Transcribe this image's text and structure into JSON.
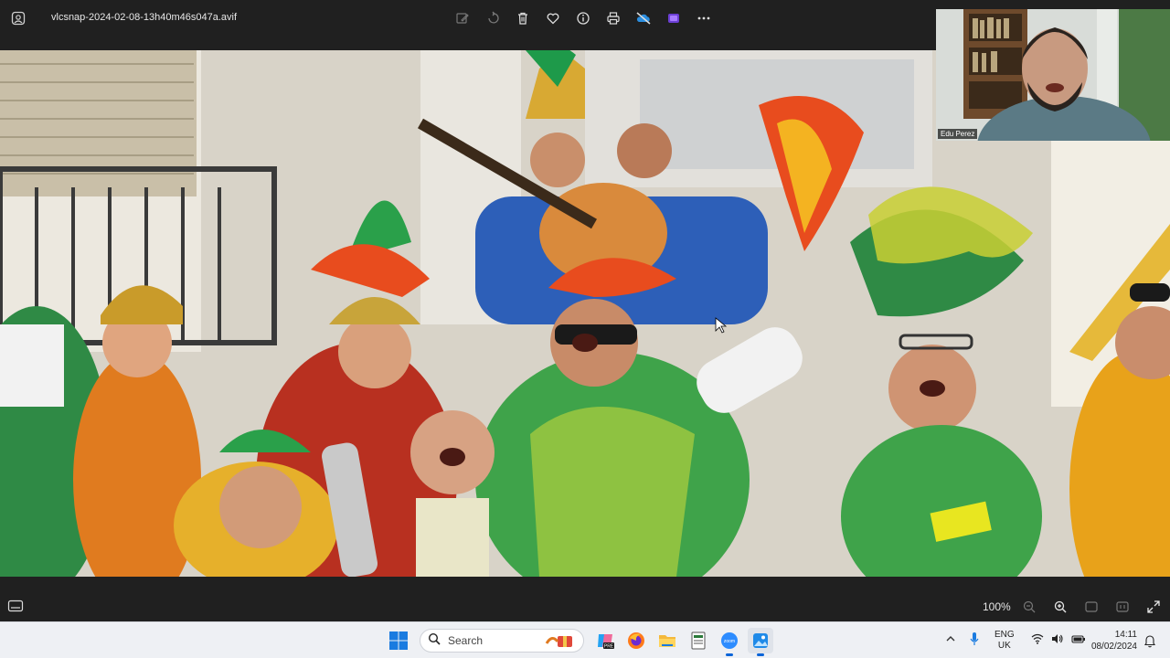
{
  "window": {
    "filename": "vlcsnap-2024-02-08-13h40m46s047a.avif"
  },
  "toolbar": {
    "buttons": [
      {
        "name": "edit-icon"
      },
      {
        "name": "rotate-icon"
      },
      {
        "name": "delete-icon"
      },
      {
        "name": "favorite-icon"
      },
      {
        "name": "info-icon"
      },
      {
        "name": "print-icon"
      },
      {
        "name": "onedrive-offline-icon"
      },
      {
        "name": "clipchamp-icon"
      },
      {
        "name": "more-icon"
      }
    ]
  },
  "camera": {
    "participant_name": "Edu Perez"
  },
  "statusbar": {
    "zoom_level": "100%"
  },
  "taskbar": {
    "search_placeholder": "Search",
    "language_line1": "ENG",
    "language_line2": "UK",
    "time": "14:11",
    "date": "08/02/2024"
  },
  "colors": {
    "app_bg": "#202020",
    "taskbar_bg": "#eef0f4",
    "accent": "#0a64d8"
  }
}
